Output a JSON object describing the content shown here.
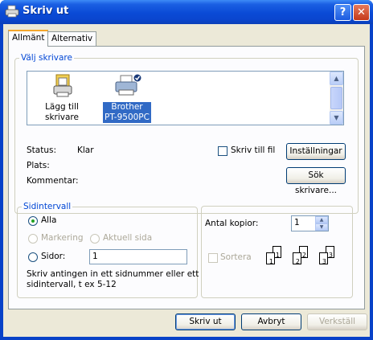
{
  "window": {
    "title": "Skriv ut",
    "help_glyph": "?",
    "close_glyph": "✕"
  },
  "tabs": [
    {
      "label": "Allmänt",
      "active": true
    },
    {
      "label": "Alternativ",
      "active": false
    }
  ],
  "select_printer": {
    "legend": "Välj skrivare",
    "printers": [
      {
        "label_line1": "Lägg till",
        "label_line2": "skrivare",
        "icon": "add-printer-icon",
        "selected": false
      },
      {
        "label_line1": "Brother",
        "label_line2": "PT-9500PC",
        "icon": "printer-icon",
        "selected": true
      }
    ],
    "status_label": "Status:",
    "status_value": "Klar",
    "location_label": "Plats:",
    "location_value": "",
    "comment_label": "Kommentar:",
    "comment_value": "",
    "print_to_file_label": "Skriv till fil",
    "print_to_file_checked": false,
    "preferences_button": "Inställningar",
    "find_printer_button": "Sök skrivare..."
  },
  "page_range": {
    "legend": "Sidintervall",
    "all_label": "Alla",
    "selection_label": "Markering",
    "current_page_label": "Aktuell sida",
    "pages_label": "Sidor:",
    "pages_value": "1",
    "hint_line1": "Skriv antingen in ett sidnummer eller ett",
    "hint_line2": "sidintervall, t ex 5-12",
    "selected_option": "all"
  },
  "copies": {
    "number_label": "Antal kopior:",
    "number_value": "1",
    "collate_label": "Sortera",
    "collate_checked": false,
    "collate_pages": [
      "1",
      "1",
      "2",
      "2",
      "3",
      "3"
    ]
  },
  "buttons": {
    "print": "Skriv ut",
    "cancel": "Avbryt",
    "apply": "Verkställ"
  },
  "colors": {
    "titlebar": "#0a4ad6",
    "legend": "#0046d5",
    "selection": "#316ac5"
  }
}
